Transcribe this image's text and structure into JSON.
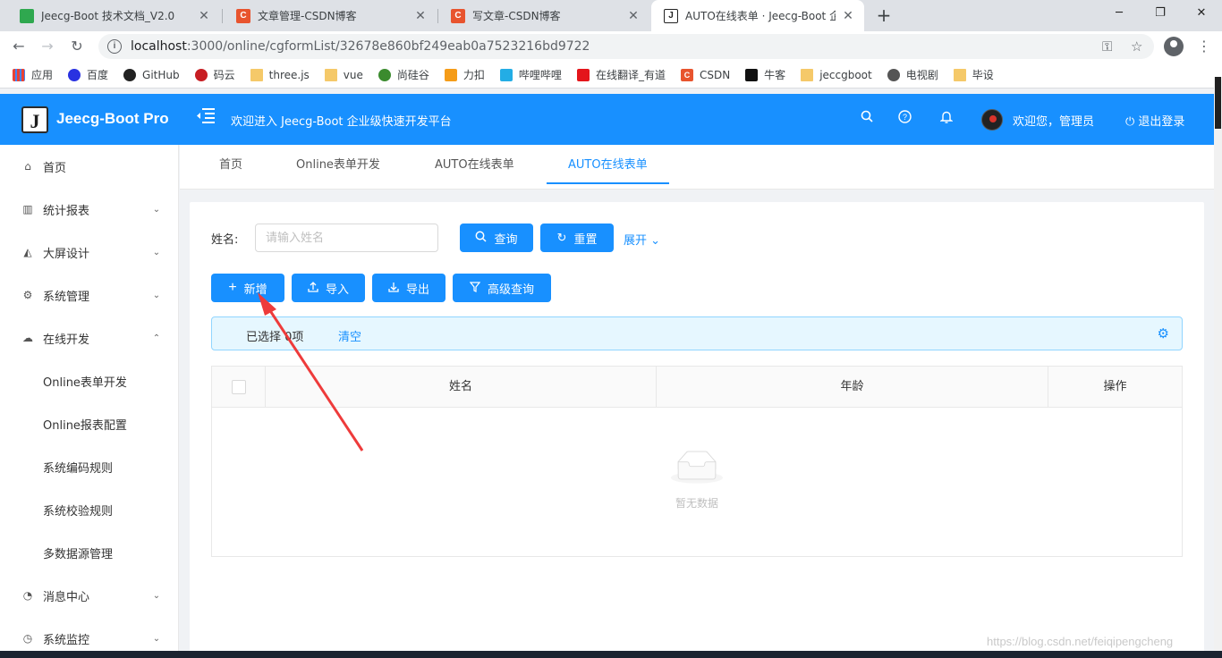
{
  "browser": {
    "tabs": [
      {
        "title": "Jeecg-Boot 技术文档_V2.0",
        "fav": "D",
        "color": "#2fa84f"
      },
      {
        "title": "文章管理-CSDN博客",
        "fav": "C",
        "color": "#e8542e"
      },
      {
        "title": "写文章-CSDN博客",
        "fav": "C",
        "color": "#e8542e"
      },
      {
        "title": "AUTO在线表单 · Jeecg-Boot 企",
        "fav": "J",
        "color": "#222222"
      }
    ],
    "url_host": "localhost",
    "url_path": ":3000/online/cgformList/32678e860bf249eab0a7523216bd9722",
    "bookmarks": [
      {
        "label": "应用",
        "icon": "apps-grid-icon",
        "color": "#4285f4"
      },
      {
        "label": "百度",
        "icon": "baidu-paw-icon",
        "color": "#2932e1"
      },
      {
        "label": "GitHub",
        "icon": "github-icon",
        "color": "#222222"
      },
      {
        "label": "码云",
        "icon": "gitee-icon",
        "color": "#c71d23"
      },
      {
        "label": "three.js",
        "icon": "folder-icon",
        "color": "#f5c969"
      },
      {
        "label": "vue",
        "icon": "folder-icon",
        "color": "#f5c969"
      },
      {
        "label": "尚硅谷",
        "icon": "atguigu-icon",
        "color": "#3b8b2e"
      },
      {
        "label": "力扣",
        "icon": "leetcode-icon",
        "color": "#f59c18"
      },
      {
        "label": "哔哩哔哩",
        "icon": "bilibili-icon",
        "color": "#23ade5"
      },
      {
        "label": "在线翻译_有道",
        "icon": "youdao-icon",
        "color": "#e4151b"
      },
      {
        "label": "CSDN",
        "icon": "csdn-icon",
        "color": "#e8542e"
      },
      {
        "label": "牛客",
        "icon": "nowcoder-icon",
        "color": "#111111"
      },
      {
        "label": "jeccgboot",
        "icon": "folder-icon",
        "color": "#f5c969"
      },
      {
        "label": "电视剧",
        "icon": "globe-icon",
        "color": "#555555"
      },
      {
        "label": "毕设",
        "icon": "folder-icon",
        "color": "#f5c969"
      }
    ]
  },
  "header": {
    "brand": "Jeecg-Boot Pro",
    "logo_letter": "J",
    "welcome": "欢迎进入 Jeecg-Boot 企业级快速开发平台",
    "user": "欢迎您，管理员",
    "logout": "退出登录",
    "color": "#1890ff"
  },
  "sidebar": {
    "items": [
      {
        "label": "首页",
        "icon": "home-icon",
        "arrow": ""
      },
      {
        "label": "统计报表",
        "icon": "bar-chart-icon",
        "arrow": "down"
      },
      {
        "label": "大屏设计",
        "icon": "area-chart-icon",
        "arrow": "down"
      },
      {
        "label": "系统管理",
        "icon": "gear-icon",
        "arrow": "down"
      },
      {
        "label": "在线开发",
        "icon": "cloud-icon",
        "arrow": "up"
      },
      {
        "label": "Online表单开发",
        "sub": true
      },
      {
        "label": "Online报表配置",
        "sub": true
      },
      {
        "label": "系统编码规则",
        "sub": true
      },
      {
        "label": "系统校验规则",
        "sub": true
      },
      {
        "label": "多数据源管理",
        "sub": true
      },
      {
        "label": "消息中心",
        "icon": "message-icon",
        "arrow": "down"
      },
      {
        "label": "系统监控",
        "icon": "dashboard-icon",
        "arrow": "down"
      }
    ]
  },
  "page_tabs": [
    "首页",
    "Online表单开发",
    "AUTO在线表单",
    "AUTO在线表单"
  ],
  "search": {
    "label": "姓名:",
    "placeholder": "请输入姓名",
    "query_btn": "查询",
    "reset_btn": "重置",
    "expand": "展开"
  },
  "toolbar": {
    "add": "新增",
    "import": "导入",
    "export": "导出",
    "advanced": "高级查询"
  },
  "selection": {
    "text": "已选择 0项",
    "clear": "清空"
  },
  "table": {
    "columns": [
      "姓名",
      "年龄",
      "操作"
    ],
    "empty_text": "暂无数据"
  },
  "watermark": "https://blog.csdn.net/feiqipengcheng"
}
